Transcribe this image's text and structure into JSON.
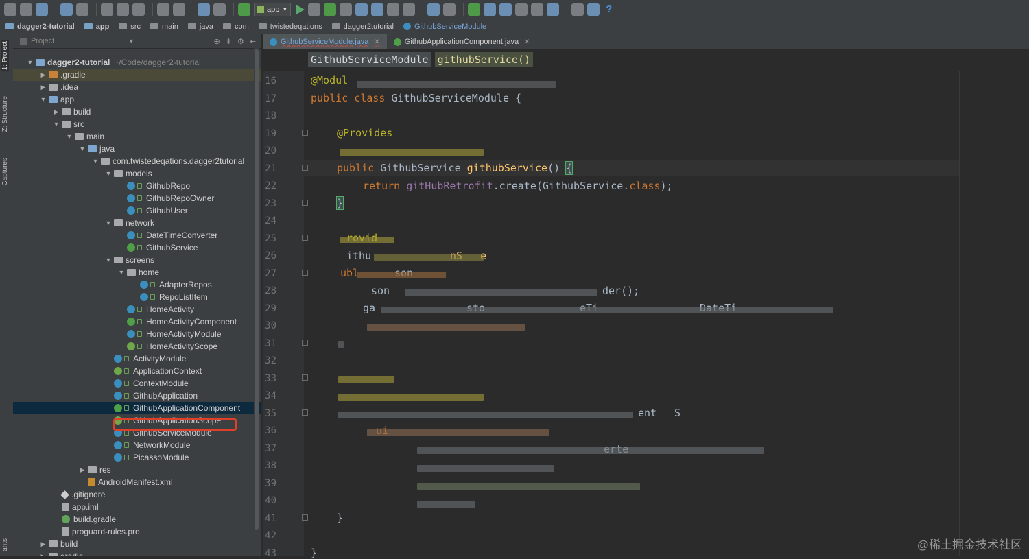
{
  "toolbar": {
    "run_config": "app"
  },
  "breadcrumbs": [
    "dagger2-tutorial",
    "app",
    "src",
    "main",
    "java",
    "com",
    "twistedeqations",
    "dagger2tutorial",
    "GithubServiceModule"
  ],
  "side_tabs": [
    "1: Project",
    "Z: Structure",
    "Captures",
    "ants"
  ],
  "project_panel": {
    "header": "Project"
  },
  "tree": [
    {
      "label": "dagger2-tutorial",
      "extra": "~/Code/dagger2-tutorial",
      "indent": 0,
      "arrow": "▼",
      "icon": "folder-blue",
      "bold": true
    },
    {
      "label": ".gradle",
      "indent": 1,
      "arrow": "▶",
      "icon": "folder-orange",
      "hl": true
    },
    {
      "label": ".idea",
      "indent": 1,
      "arrow": "▶",
      "icon": "folder"
    },
    {
      "label": "app",
      "indent": 1,
      "arrow": "▼",
      "icon": "folder-blue"
    },
    {
      "label": "build",
      "indent": 2,
      "arrow": "▶",
      "icon": "folder"
    },
    {
      "label": "src",
      "indent": 2,
      "arrow": "▼",
      "icon": "folder"
    },
    {
      "label": "main",
      "indent": 3,
      "arrow": "▼",
      "icon": "folder"
    },
    {
      "label": "java",
      "indent": 4,
      "arrow": "▼",
      "icon": "folder-blue"
    },
    {
      "label": "com.twistedeqations.dagger2tutorial",
      "indent": 5,
      "arrow": "▼",
      "icon": "folder"
    },
    {
      "label": "models",
      "indent": 6,
      "arrow": "▼",
      "icon": "folder"
    },
    {
      "label": "GithubRepo",
      "indent": 7,
      "icon": "class"
    },
    {
      "label": "GithubRepoOwner",
      "indent": 7,
      "icon": "class"
    },
    {
      "label": "GithubUser",
      "indent": 7,
      "icon": "class"
    },
    {
      "label": "network",
      "indent": 6,
      "arrow": "▼",
      "icon": "folder"
    },
    {
      "label": "DateTimeConverter",
      "indent": 7,
      "icon": "class"
    },
    {
      "label": "GithubService",
      "indent": 7,
      "icon": "interface"
    },
    {
      "label": "screens",
      "indent": 6,
      "arrow": "▼",
      "icon": "folder"
    },
    {
      "label": "home",
      "indent": 7,
      "arrow": "▼",
      "icon": "folder"
    },
    {
      "label": "AdapterRepos",
      "indent": 8,
      "icon": "class"
    },
    {
      "label": "RepoListItem",
      "indent": 8,
      "icon": "class"
    },
    {
      "label": "HomeActivity",
      "indent": 7,
      "icon": "class"
    },
    {
      "label": "HomeActivityComponent",
      "indent": 7,
      "icon": "interface"
    },
    {
      "label": "HomeActivityModule",
      "indent": 7,
      "icon": "class"
    },
    {
      "label": "HomeActivityScope",
      "indent": 7,
      "icon": "annotation"
    },
    {
      "label": "ActivityModule",
      "indent": 6,
      "icon": "class"
    },
    {
      "label": "ApplicationContext",
      "indent": 6,
      "icon": "annotation"
    },
    {
      "label": "ContextModule",
      "indent": 6,
      "icon": "class"
    },
    {
      "label": "GithubApplication",
      "indent": 6,
      "icon": "class"
    },
    {
      "label": "GithubApplicationComponent",
      "indent": 6,
      "icon": "interface",
      "selected": true
    },
    {
      "label": "GithubApplicationScope",
      "indent": 6,
      "icon": "annotation"
    },
    {
      "label": "GithubServiceModule",
      "indent": 6,
      "icon": "class"
    },
    {
      "label": "NetworkModule",
      "indent": 6,
      "icon": "class"
    },
    {
      "label": "PicassoModule",
      "indent": 6,
      "icon": "class"
    },
    {
      "label": "res",
      "indent": 4,
      "arrow": "▶",
      "icon": "folder"
    },
    {
      "label": "AndroidManifest.xml",
      "indent": 4,
      "icon": "xml"
    },
    {
      "label": ".gitignore",
      "indent": 2,
      "icon": "git"
    },
    {
      "label": "app.iml",
      "indent": 2,
      "icon": "file"
    },
    {
      "label": "build.gradle",
      "indent": 2,
      "icon": "gradle"
    },
    {
      "label": "proguard-rules.pro",
      "indent": 2,
      "icon": "file"
    },
    {
      "label": "build",
      "indent": 1,
      "arrow": "▶",
      "icon": "folder"
    },
    {
      "label": "gradle",
      "indent": 1,
      "arrow": "▶",
      "icon": "folder"
    }
  ],
  "editor_tabs": [
    {
      "label": "GithubServiceModule.java",
      "active": true
    },
    {
      "label": "GithubApplicationComponent.java",
      "active": false
    }
  ],
  "nav": {
    "class_name": "GithubServiceModule",
    "method_name": "githubService()"
  },
  "line_numbers": [
    16,
    17,
    18,
    19,
    20,
    21,
    22,
    23,
    24,
    25,
    26,
    27,
    28,
    29,
    30,
    31,
    32,
    33,
    34,
    35,
    36,
    37,
    38,
    39,
    40,
    41,
    42,
    43
  ],
  "code": {
    "l16": "@Modul",
    "l17_kw": "public class ",
    "l17_name": "GithubServiceModule {",
    "l19": "@Provides",
    "l21_kw": "public ",
    "l21_type": "GithubService ",
    "l21_method": "githubService",
    "l21_rest": "() ",
    "l21_brace": "{",
    "l22_kw": "return ",
    "l22_field": "gitHubRetrofit",
    "l22_rest1": ".create(GithubService.",
    "l22_kw2": "class",
    "l22_rest2": ");",
    "l23": "}",
    "l25": "rovid",
    "l26_a": "ithu",
    "l26_b": "nS",
    "l26_c": "e",
    "l27_a": "ubl",
    "l27_b": "son",
    "l28_a": "son",
    "l28_b": "der();",
    "l29_a": "ga",
    "l29_b": "sto",
    "l29_c": "eTi",
    "l29_d": "DateTi",
    "l35_a": "ent",
    "l35_b": "S",
    "l36_a": "ui",
    "l37_a": "erte",
    "l41": "}",
    "l43": "}"
  },
  "watermark": "@稀土掘金技术社区"
}
